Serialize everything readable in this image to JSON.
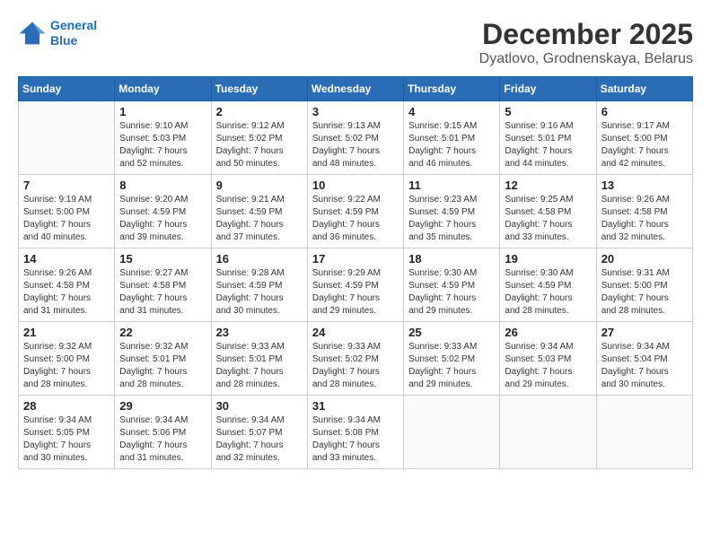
{
  "logo": {
    "line1": "General",
    "line2": "Blue"
  },
  "title": "December 2025",
  "location": "Dyatlovo, Grodnenskaya, Belarus",
  "days_of_week": [
    "Sunday",
    "Monday",
    "Tuesday",
    "Wednesday",
    "Thursday",
    "Friday",
    "Saturday"
  ],
  "weeks": [
    [
      {
        "day": "",
        "info": ""
      },
      {
        "day": "1",
        "info": "Sunrise: 9:10 AM\nSunset: 5:03 PM\nDaylight: 7 hours\nand 52 minutes."
      },
      {
        "day": "2",
        "info": "Sunrise: 9:12 AM\nSunset: 5:02 PM\nDaylight: 7 hours\nand 50 minutes."
      },
      {
        "day": "3",
        "info": "Sunrise: 9:13 AM\nSunset: 5:02 PM\nDaylight: 7 hours\nand 48 minutes."
      },
      {
        "day": "4",
        "info": "Sunrise: 9:15 AM\nSunset: 5:01 PM\nDaylight: 7 hours\nand 46 minutes."
      },
      {
        "day": "5",
        "info": "Sunrise: 9:16 AM\nSunset: 5:01 PM\nDaylight: 7 hours\nand 44 minutes."
      },
      {
        "day": "6",
        "info": "Sunrise: 9:17 AM\nSunset: 5:00 PM\nDaylight: 7 hours\nand 42 minutes."
      }
    ],
    [
      {
        "day": "7",
        "info": "Sunrise: 9:19 AM\nSunset: 5:00 PM\nDaylight: 7 hours\nand 40 minutes."
      },
      {
        "day": "8",
        "info": "Sunrise: 9:20 AM\nSunset: 4:59 PM\nDaylight: 7 hours\nand 39 minutes."
      },
      {
        "day": "9",
        "info": "Sunrise: 9:21 AM\nSunset: 4:59 PM\nDaylight: 7 hours\nand 37 minutes."
      },
      {
        "day": "10",
        "info": "Sunrise: 9:22 AM\nSunset: 4:59 PM\nDaylight: 7 hours\nand 36 minutes."
      },
      {
        "day": "11",
        "info": "Sunrise: 9:23 AM\nSunset: 4:59 PM\nDaylight: 7 hours\nand 35 minutes."
      },
      {
        "day": "12",
        "info": "Sunrise: 9:25 AM\nSunset: 4:58 PM\nDaylight: 7 hours\nand 33 minutes."
      },
      {
        "day": "13",
        "info": "Sunrise: 9:26 AM\nSunset: 4:58 PM\nDaylight: 7 hours\nand 32 minutes."
      }
    ],
    [
      {
        "day": "14",
        "info": "Sunrise: 9:26 AM\nSunset: 4:58 PM\nDaylight: 7 hours\nand 31 minutes."
      },
      {
        "day": "15",
        "info": "Sunrise: 9:27 AM\nSunset: 4:58 PM\nDaylight: 7 hours\nand 31 minutes."
      },
      {
        "day": "16",
        "info": "Sunrise: 9:28 AM\nSunset: 4:59 PM\nDaylight: 7 hours\nand 30 minutes."
      },
      {
        "day": "17",
        "info": "Sunrise: 9:29 AM\nSunset: 4:59 PM\nDaylight: 7 hours\nand 29 minutes."
      },
      {
        "day": "18",
        "info": "Sunrise: 9:30 AM\nSunset: 4:59 PM\nDaylight: 7 hours\nand 29 minutes."
      },
      {
        "day": "19",
        "info": "Sunrise: 9:30 AM\nSunset: 4:59 PM\nDaylight: 7 hours\nand 28 minutes."
      },
      {
        "day": "20",
        "info": "Sunrise: 9:31 AM\nSunset: 5:00 PM\nDaylight: 7 hours\nand 28 minutes."
      }
    ],
    [
      {
        "day": "21",
        "info": "Sunrise: 9:32 AM\nSunset: 5:00 PM\nDaylight: 7 hours\nand 28 minutes."
      },
      {
        "day": "22",
        "info": "Sunrise: 9:32 AM\nSunset: 5:01 PM\nDaylight: 7 hours\nand 28 minutes."
      },
      {
        "day": "23",
        "info": "Sunrise: 9:33 AM\nSunset: 5:01 PM\nDaylight: 7 hours\nand 28 minutes."
      },
      {
        "day": "24",
        "info": "Sunrise: 9:33 AM\nSunset: 5:02 PM\nDaylight: 7 hours\nand 28 minutes."
      },
      {
        "day": "25",
        "info": "Sunrise: 9:33 AM\nSunset: 5:02 PM\nDaylight: 7 hours\nand 29 minutes."
      },
      {
        "day": "26",
        "info": "Sunrise: 9:34 AM\nSunset: 5:03 PM\nDaylight: 7 hours\nand 29 minutes."
      },
      {
        "day": "27",
        "info": "Sunrise: 9:34 AM\nSunset: 5:04 PM\nDaylight: 7 hours\nand 30 minutes."
      }
    ],
    [
      {
        "day": "28",
        "info": "Sunrise: 9:34 AM\nSunset: 5:05 PM\nDaylight: 7 hours\nand 30 minutes."
      },
      {
        "day": "29",
        "info": "Sunrise: 9:34 AM\nSunset: 5:06 PM\nDaylight: 7 hours\nand 31 minutes."
      },
      {
        "day": "30",
        "info": "Sunrise: 9:34 AM\nSunset: 5:07 PM\nDaylight: 7 hours\nand 32 minutes."
      },
      {
        "day": "31",
        "info": "Sunrise: 9:34 AM\nSunset: 5:08 PM\nDaylight: 7 hours\nand 33 minutes."
      },
      {
        "day": "",
        "info": ""
      },
      {
        "day": "",
        "info": ""
      },
      {
        "day": "",
        "info": ""
      }
    ]
  ]
}
